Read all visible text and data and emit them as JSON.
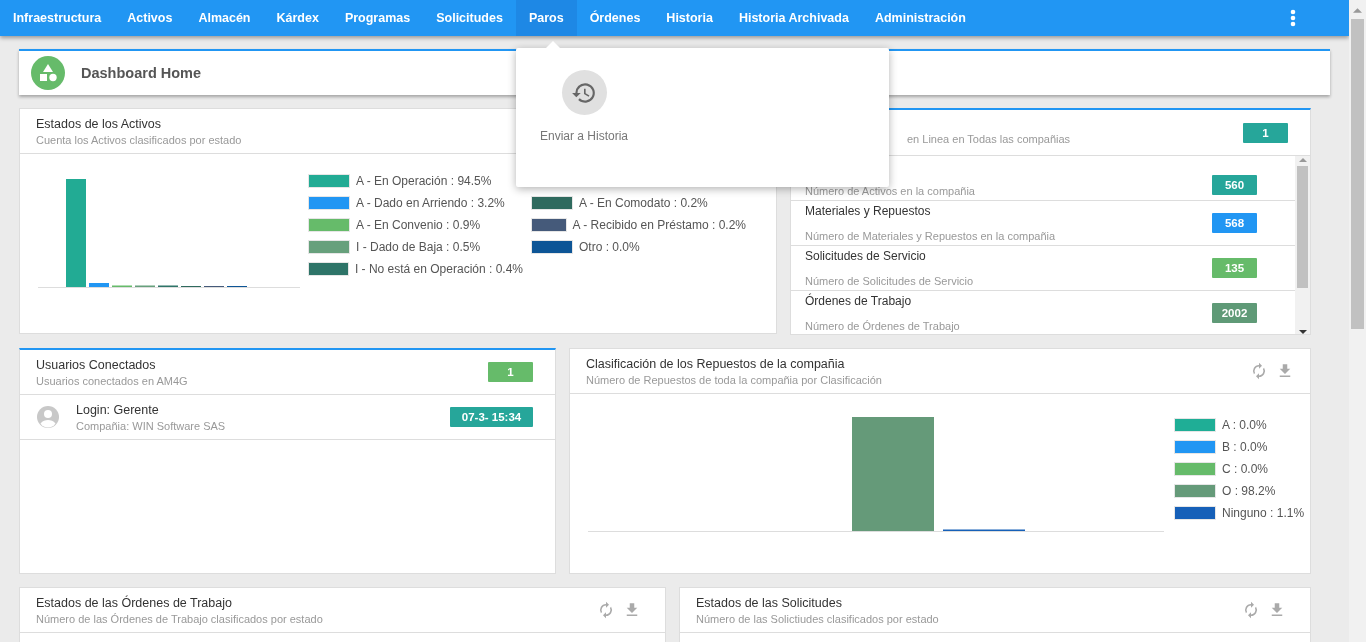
{
  "nav": {
    "items": [
      {
        "label": "Infraestructura",
        "selected": false
      },
      {
        "label": "Activos",
        "selected": false
      },
      {
        "label": "Almacén",
        "selected": false
      },
      {
        "label": "Kárdex",
        "selected": false
      },
      {
        "label": "Programas",
        "selected": false
      },
      {
        "label": "Solicitudes",
        "selected": false
      },
      {
        "label": "Paros",
        "selected": true
      },
      {
        "label": "Órdenes",
        "selected": false
      },
      {
        "label": "Historia",
        "selected": false
      },
      {
        "label": "Historia Archivada",
        "selected": false
      },
      {
        "label": "Administración",
        "selected": false
      }
    ],
    "menu": {
      "items": [
        {
          "label": "Enviar a Historia"
        }
      ]
    }
  },
  "header": {
    "title": "Dashboard Home"
  },
  "asset_states": {
    "title": "Estados de los Activos",
    "subtitle": "Cuenta los Activos clasificados por estado",
    "legend": [
      {
        "label": "A - En Operación : 94.5%",
        "color": "#22ab94"
      },
      {
        "label": "A - Dado en Arriendo : 3.2%",
        "color": "#2196f3"
      },
      {
        "label": "A - En Convenio : 0.9%",
        "color": "#66bb6a"
      },
      {
        "label": "I - Dado de Baja : 0.5%",
        "color": "#67a07c"
      },
      {
        "label": "I - No está en Operación : 0.4%",
        "color": "#2e7468"
      },
      {
        "label": "A - En Comodato : 0.2%",
        "color": "#2f6a5e"
      },
      {
        "label": "A - Recibido en Préstamo : 0.2%",
        "color": "#455a7a"
      },
      {
        "label": "Otro : 0.0%",
        "color": "#0d5596"
      }
    ]
  },
  "online": {
    "subtitle": "en Linea en Todas las compañias",
    "count": "1",
    "color": "#26a69a",
    "stats": [
      {
        "subtitle": "Número de Activos en la compañia",
        "count": "560",
        "color": "#26a69a"
      },
      {
        "title": "Materiales y Repuestos",
        "subtitle": "Número de Materiales y Repuestos en la compañia",
        "count": "568",
        "color": "#2196f3"
      },
      {
        "title": "Solicitudes de Servicio",
        "subtitle": "Número de Solicitudes de Servicio",
        "count": "135",
        "color": "#66bb6a"
      },
      {
        "title": "Órdenes de Trabajo",
        "subtitle": "Número de Órdenes de Trabajo",
        "count": "2002",
        "color": "#5f9a77"
      }
    ]
  },
  "users": {
    "title": "Usuarios Conectados",
    "subtitle": "Usuarios conectados en AM4G",
    "count": "1",
    "color": "#66bb6a",
    "rows": [
      {
        "login": "Login: Gerente",
        "company": "Compañia: WIN Software SAS",
        "time": "07-3- 15:34"
      }
    ]
  },
  "parts": {
    "title": "Clasificación de los Repuestos de la compañia",
    "subtitle": "Número de Repuestos de toda la compañia por Clasificación",
    "legend": [
      {
        "label": "A : 0.0%",
        "color": "#1fae96"
      },
      {
        "label": "B : 0.0%",
        "color": "#2196f3"
      },
      {
        "label": "C : 0.0%",
        "color": "#66bb6a"
      },
      {
        "label": "O : 98.2%",
        "color": "#659a79"
      },
      {
        "label": "Ninguno : 1.1%",
        "color": "#1660b8"
      }
    ]
  },
  "orders": {
    "title": "Estados de las Órdenes de Trabajo",
    "subtitle": "Número de las Órdenes de Trabajo clasificados por estado"
  },
  "requests": {
    "title": "Estados de las Solicitudes",
    "subtitle": "Número de las Solictiudes clasificados por estado"
  }
}
